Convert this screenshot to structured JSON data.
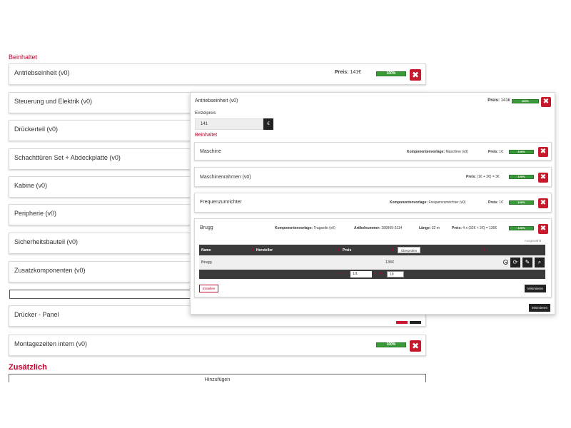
{
  "sections": {
    "contains_label": "Beinhaltet",
    "additional_label": "Zusätzlich",
    "add_button_label": "Hinzufügen"
  },
  "rows": [
    {
      "name": "Antriebseinheit (v0)",
      "price_label": "Preis:",
      "price_value": "141€",
      "progress_label": "100%",
      "progress": 1.0
    },
    {
      "name": "Steuerung und Elektrik (v0)"
    },
    {
      "name": "Drückerteil (v0)"
    },
    {
      "name": "Schachttüren Set + Abdeckplatte (v0)"
    },
    {
      "name": "Kabine (v0)"
    },
    {
      "name": "Peripherie (v0)"
    },
    {
      "name": "Sicherheitsbauteil (v0)"
    },
    {
      "name": "Zusatzkomponenten (v0)"
    },
    {
      "name": "Drücker - Panel"
    },
    {
      "name": "Montagezeiten intern (v0)",
      "progress_label": "100%",
      "progress": 1.0
    }
  ],
  "overlay": {
    "title": "Antriebseinheit (v0)",
    "price_label": "Preis:",
    "price_value": "141€",
    "progress_label": "100%",
    "unit_price_label": "Einzelpreis",
    "unit_price_value": "141",
    "currency_symbol": "€",
    "contains_label": "Beinhaltet",
    "items": [
      {
        "name": "Maschine",
        "template_label": "Komponentenvorlage:",
        "template_value": "Maschine (v0)",
        "price_label": "Preis:",
        "price_value": "1€",
        "progress_label": "100%"
      },
      {
        "name": "Maschinenrahmen (v0)",
        "price_label": "Preis:",
        "price_value": "(1€ + 2€) = 3€",
        "progress_label": "100%"
      },
      {
        "name": "Frequenzumrichter",
        "template_label": "Komponentenvorlage:",
        "template_value": "Frequenzumrichter (v0)",
        "price_label": "Preis:",
        "price_value": "1€",
        "progress_label": "100%"
      },
      {
        "name": "Brugg",
        "template_label": "Komponentenvorlage:",
        "template_value": "Tragseile (v0)",
        "article_label": "Artikelnummer:",
        "article_value": "189969-3114",
        "length_label": "Länge:",
        "length_value": "32 m",
        "price_label": "Preis:",
        "price_value": "4 x (32€ + 2€) = 136€",
        "progress_label": "100%"
      }
    ],
    "selected_label": "Ausgewählt",
    "table": {
      "columns": [
        "Name",
        "Hersteller",
        "Preis"
      ],
      "filter_button": "Überprüfen",
      "row": {
        "name": "Brugg",
        "price": "136€"
      },
      "page_input": "1/1",
      "page_size": "10"
    },
    "create_button": "Erstellen",
    "minimize_button": "Minimieren",
    "minimize_outer_button": "Minimieren"
  },
  "colors": {
    "accent": "#c0002a",
    "delete": "#c61a2c",
    "progress": "#3a9a3a",
    "dark": "#222222"
  }
}
